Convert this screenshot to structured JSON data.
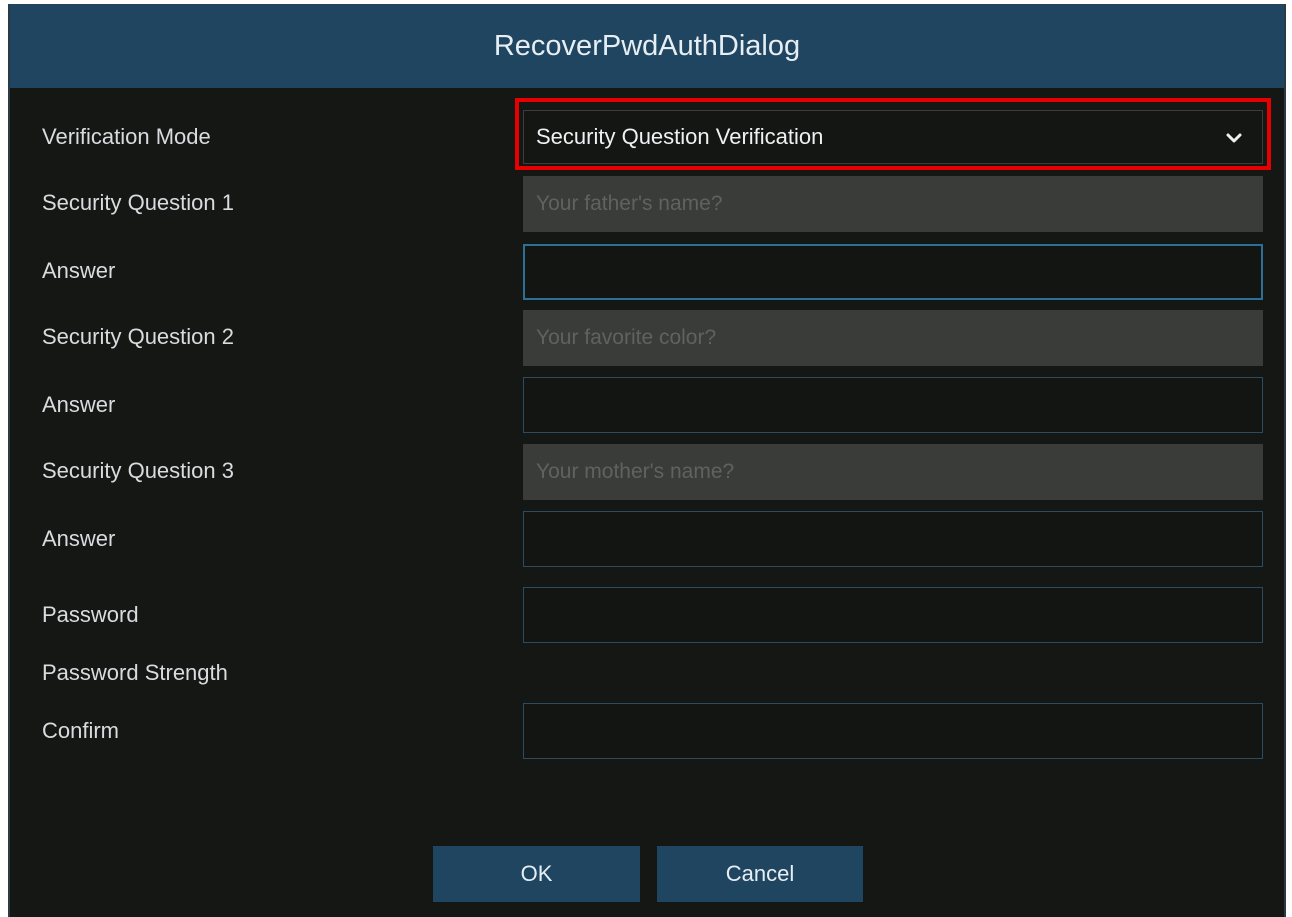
{
  "dialog": {
    "title": "RecoverPwdAuthDialog"
  },
  "form": {
    "verification_mode": {
      "label": "Verification Mode",
      "selected": "Security Question Verification"
    },
    "question1": {
      "label": "Security Question 1",
      "value": "Your father's name?"
    },
    "answer1": {
      "label": "Answer",
      "value": ""
    },
    "question2": {
      "label": "Security Question 2",
      "value": "Your favorite color?"
    },
    "answer2": {
      "label": "Answer",
      "value": ""
    },
    "question3": {
      "label": "Security Question 3",
      "value": "Your mother's name?"
    },
    "answer3": {
      "label": "Answer",
      "value": ""
    },
    "password": {
      "label": "Password",
      "value": ""
    },
    "password_strength": {
      "label": "Password Strength"
    },
    "confirm": {
      "label": "Confirm",
      "value": ""
    }
  },
  "buttons": {
    "ok": "OK",
    "cancel": "Cancel"
  },
  "colors": {
    "title_bar": "#1f4560",
    "background": "#141714",
    "highlight": "#e60000",
    "field_border": "#2c4b61"
  },
  "icons": {
    "dropdown": "chevron-down-icon"
  }
}
